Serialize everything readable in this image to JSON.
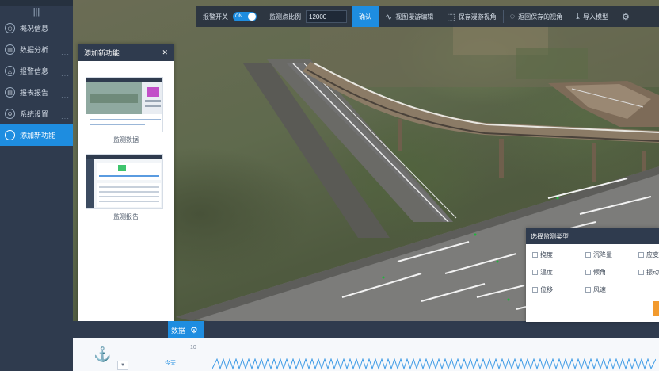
{
  "sidebar": {
    "items": [
      {
        "label": "概况信息",
        "icon": "gauge-icon",
        "glyph": "◷"
      },
      {
        "label": "数据分析",
        "icon": "bar-chart-icon",
        "glyph": "▥"
      },
      {
        "label": "报警信息",
        "icon": "warning-icon",
        "glyph": "△"
      },
      {
        "label": "报表报告",
        "icon": "report-icon",
        "glyph": "▤"
      },
      {
        "label": "系统设置",
        "icon": "gear-icon",
        "glyph": "⚙"
      },
      {
        "label": "添加新功能",
        "icon": "info-icon",
        "glyph": "!"
      }
    ],
    "active_index": 5
  },
  "toolbar": {
    "alert_switch_label": "报警开关",
    "toggle_state": "ON",
    "scale_label": "监测点比例",
    "scale_value": "12000",
    "confirm_label": "确认",
    "buttons": [
      {
        "label": "视图漫游编辑",
        "icon": "wave-icon",
        "glyph": "∿"
      },
      {
        "label": "保存漫游视角",
        "icon": "save-icon",
        "glyph": "⬚"
      },
      {
        "label": "返回保存的视角",
        "icon": "return-icon",
        "glyph": "◌"
      },
      {
        "label": "导入模型",
        "icon": "import-icon",
        "glyph": "⤓"
      }
    ]
  },
  "panel": {
    "title": "添加新功能",
    "cards": [
      {
        "caption": "监测数据"
      },
      {
        "caption": "监测报告"
      }
    ]
  },
  "bottom": {
    "tab_label": "数据",
    "y_tick": "10",
    "day_label": "今天"
  },
  "popup": {
    "title": "选择监测类型",
    "options": [
      "挠度",
      "沉降量",
      "应变",
      "温度",
      "倾角",
      "振动",
      "位移",
      "风速"
    ]
  },
  "colors": {
    "accent": "#1e8de0",
    "dark": "#2f3b4e",
    "orange": "#f29a2e"
  }
}
